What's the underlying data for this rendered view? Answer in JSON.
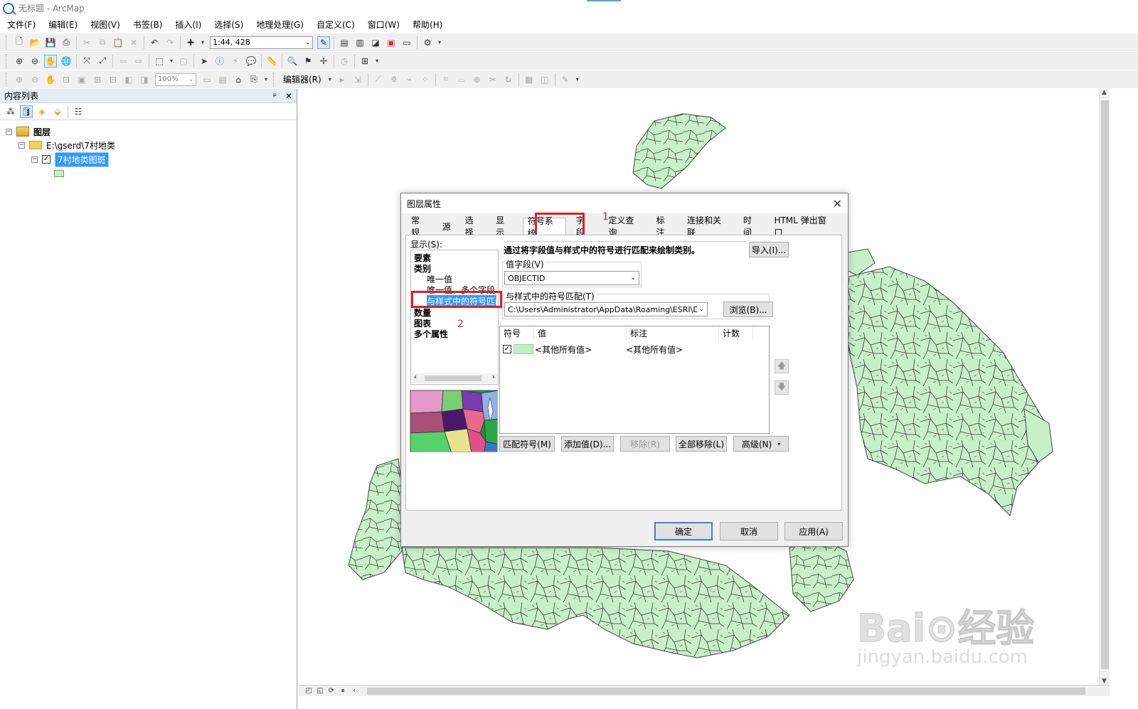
{
  "window": {
    "title": "无标题 - ArcMap"
  },
  "menu": [
    "文件(F)",
    "编辑(E)",
    "视图(V)",
    "书签(B)",
    "插入(I)",
    "选择(S)",
    "地理处理(G)",
    "自定义(C)",
    "窗口(W)",
    "帮助(H)"
  ],
  "toolbar": {
    "scale": "1:44, 428",
    "zoom": "100%",
    "editor": "编辑器(R)"
  },
  "toc": {
    "title": "内容列表",
    "pin": "ᵖ",
    "close": "✕",
    "root": "图层",
    "folder": "E:\\gserd\\7村地类",
    "layer": "7村地类图斑"
  },
  "dialog": {
    "title": "图层属性",
    "tabs": [
      "常规",
      "源",
      "选择",
      "显示",
      "符号系统",
      "字段",
      "定义查询",
      "标注",
      "连接和关联",
      "时间",
      "HTML 弹出窗口"
    ],
    "annotation1": "1",
    "annotation2": "2",
    "show_label": "显示(S):",
    "show_items": [
      {
        "label": "要素",
        "bold": true
      },
      {
        "label": "类别",
        "bold": true
      },
      {
        "label": "唯一值",
        "bold": false
      },
      {
        "label": "唯一值，多个字段",
        "bold": false
      },
      {
        "label": "与样式中的符号匹配",
        "bold": false
      },
      {
        "label": "数量",
        "bold": true
      },
      {
        "label": "图表",
        "bold": true
      },
      {
        "label": "多个属性",
        "bold": true
      }
    ],
    "description": "通过将字段值与样式中的符号进行匹配来绘制类别。",
    "import_button": "导入(I)...",
    "value_field_label": "值字段(V)",
    "value_field": "OBJECTID",
    "style_label": "与样式中的符号匹配(T)",
    "style_path": "C:\\Users\\Administrator\\AppData\\Roaming\\ESRI\\Desktop",
    "browse_button": "浏览(B)...",
    "grid_headers": [
      "符号",
      "值",
      "标注",
      "计数"
    ],
    "grid_row": {
      "value": "<其他所有值>",
      "label": "<其他所有值>",
      "checked": true
    },
    "buttons": {
      "match": "匹配符号(M)",
      "add": "添加值(D)...",
      "remove": "移除(R)",
      "remove_all": "全部移除(L)",
      "advanced": "高级(N)"
    },
    "footer": {
      "ok": "确定",
      "cancel": "取消",
      "apply": "应用(A)"
    }
  },
  "watermark": {
    "logo": "Bai⊙经验",
    "url": "jingyan.baidu.com"
  },
  "colors": {
    "polygon_fill": "#c8f0c8",
    "polygon_stroke": "#4a4a4a",
    "highlight": "#e02020",
    "selection": "#3399ff"
  }
}
